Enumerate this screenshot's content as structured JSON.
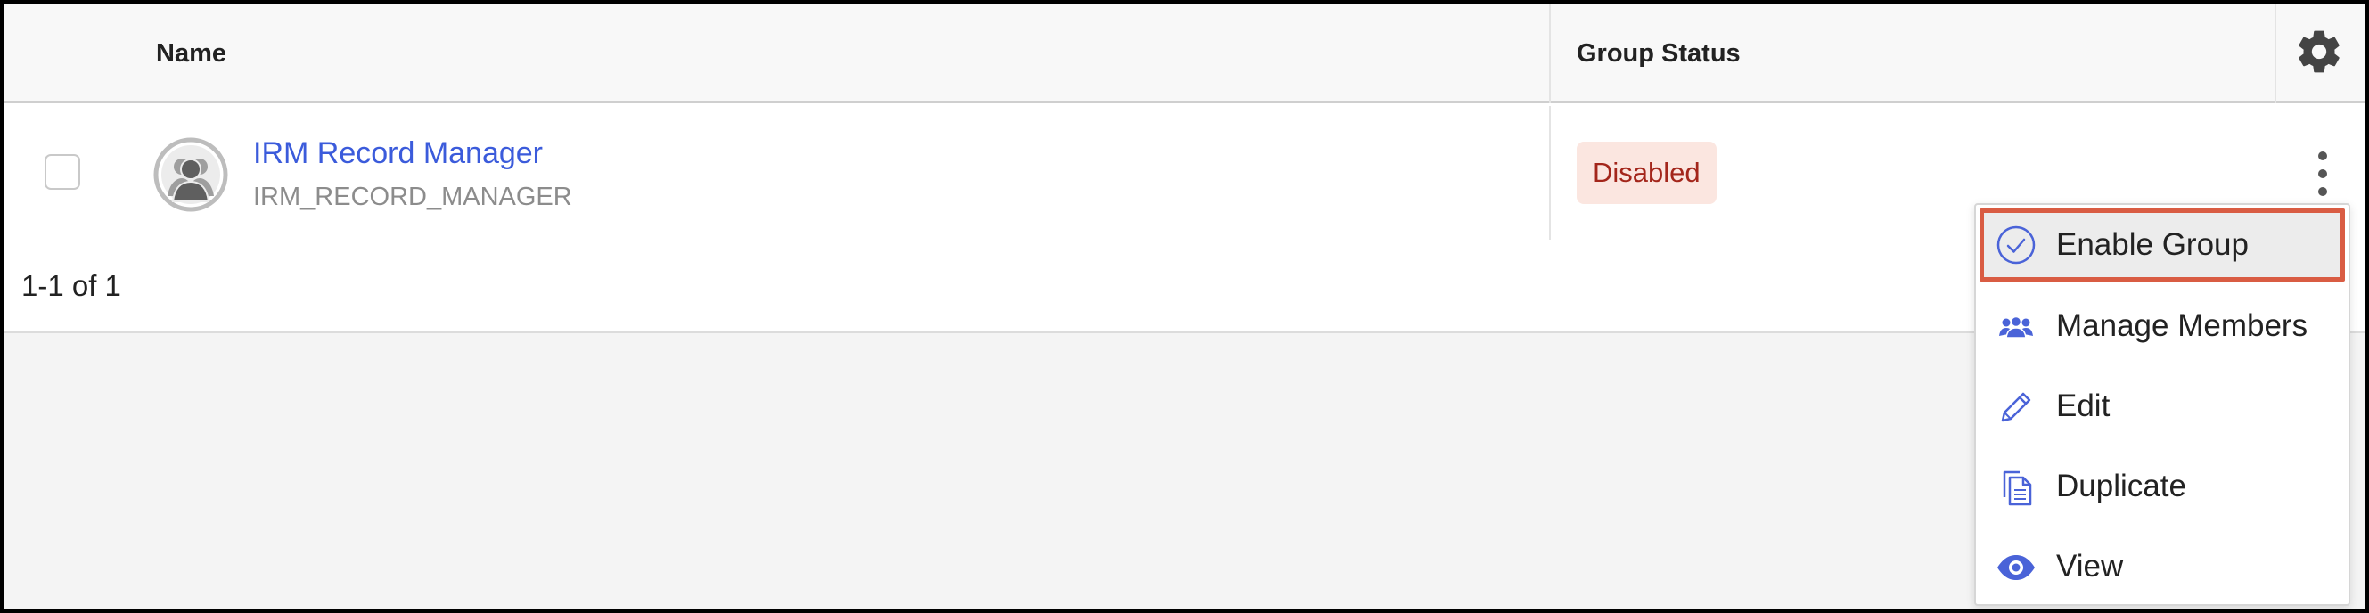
{
  "table": {
    "columns": {
      "name": "Name",
      "group_status": "Group Status"
    },
    "settings_icon": "gear-icon",
    "rows": [
      {
        "name": "IRM Record Manager",
        "code": "IRM_RECORD_MANAGER",
        "status": "Disabled",
        "avatar_icon": "group-avatar-icon",
        "actions_icon": "more-vertical-icon"
      }
    ],
    "pagination": "1-1 of 1"
  },
  "context_menu": {
    "items": [
      {
        "label": "Enable Group",
        "icon": "check-circle-icon",
        "highlighted": true
      },
      {
        "label": "Manage Members",
        "icon": "members-icon"
      },
      {
        "label": "Edit",
        "icon": "pencil-icon"
      },
      {
        "label": "Duplicate",
        "icon": "duplicate-icon"
      },
      {
        "label": "View",
        "icon": "eye-icon"
      }
    ]
  },
  "colors": {
    "link": "#3b5bdb",
    "badge_bg": "#fbe6e0",
    "badge_text": "#a3261b",
    "icon_blue": "#4a63d8",
    "highlight_border": "#d95c43"
  }
}
